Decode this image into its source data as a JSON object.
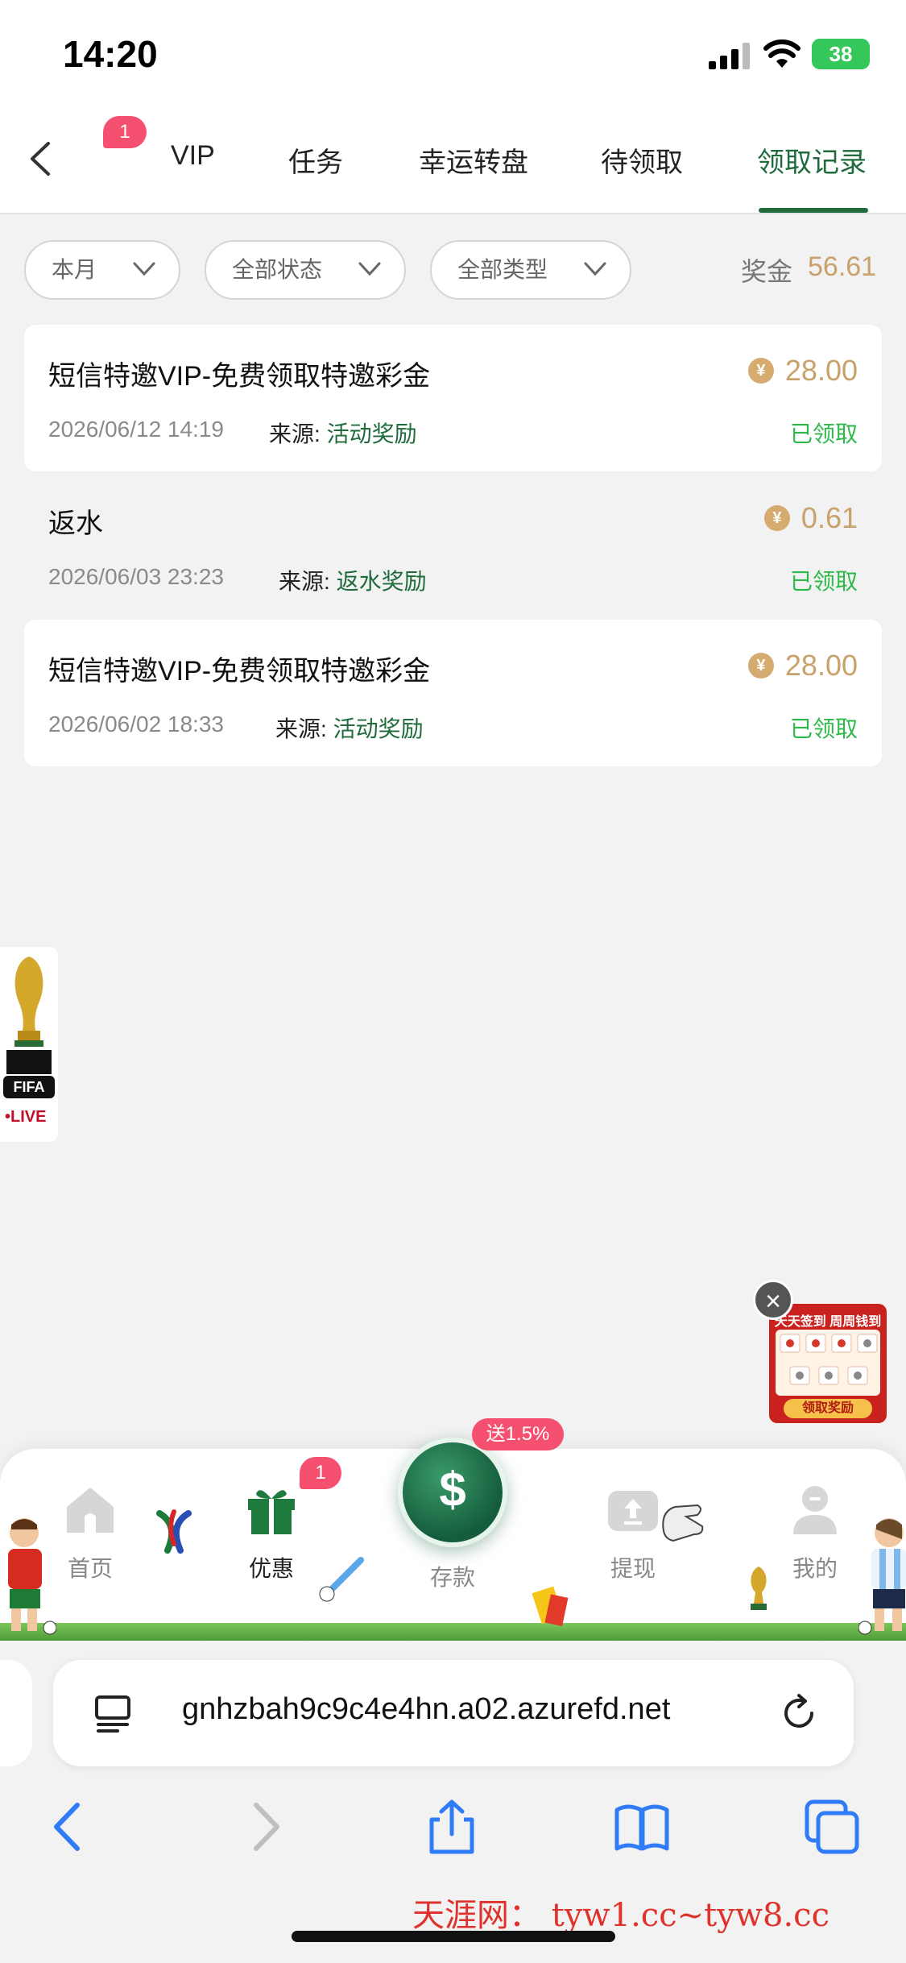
{
  "status_bar": {
    "time": "14:20",
    "battery": "38"
  },
  "tabs": {
    "badge": "1",
    "items": [
      "VIP",
      "任务",
      "幸运转盘",
      "待领取",
      "领取记录"
    ],
    "active": "领取记录"
  },
  "filters": {
    "month": "本月",
    "status": "全部状态",
    "type": "全部类型",
    "prize_label": "奖金",
    "prize_value": "56.61"
  },
  "records": [
    {
      "title": "短信特邀VIP-免费领取特邀彩金",
      "amount": "28.00",
      "date": "2026/06/12 14:19",
      "source_label": "来源:",
      "source": "活动奖励",
      "status": "已领取"
    },
    {
      "title": "返水",
      "amount": "0.61",
      "date": "2026/06/03 23:23",
      "source_label": "来源:",
      "source": "返水奖励",
      "status": "已领取"
    },
    {
      "title": "短信特邀VIP-免费领取特邀彩金",
      "amount": "28.00",
      "date": "2026/06/02 18:33",
      "source_label": "来源:",
      "source": "活动奖励",
      "status": "已领取"
    }
  ],
  "currency_symbol": "¥",
  "fifa_widget": {
    "badge": "FIFA",
    "live": "•LIVE"
  },
  "checkin_widget": {
    "title": "天天签到 周周钱到",
    "button": "领取奖励"
  },
  "bottom_nav": {
    "items": [
      "首页",
      "优惠",
      "存款",
      "提现",
      "我的"
    ],
    "active": "优惠",
    "promo_badge": "1",
    "deposit_promo": "送1.5%"
  },
  "browser": {
    "url": "gnhzbah9c9c4e4hn.a02.azurefd.net"
  },
  "watermark": "天涯网： tyw1.cc~tyw8.cc",
  "colors": {
    "brand_green": "#1f6b3b",
    "gold": "#c9a16a",
    "status_green": "#2db84a",
    "badge_pink": "#f5506f"
  }
}
